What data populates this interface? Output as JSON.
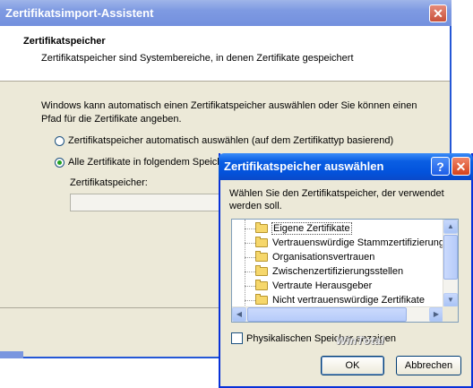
{
  "wizard": {
    "title": "Zertifikatsimport-Assistent",
    "close_symbol": "✕",
    "header_title": "Zertifikatspeicher",
    "header_subtitle": "Zertifikatspeicher sind Systembereiche, in denen Zertifikate gespeichert",
    "intro_text": "Windows kann automatisch einen Zertifikatspeicher auswählen oder Sie können einen Pfad für die Zertifikate angeben.",
    "radio_auto_label": "Zertifikatspeicher automatisch auswählen (auf dem Zertifikattyp basierend)",
    "radio_manual_label": "Alle Zertifikate in folgendem Speicher speichern",
    "store_label": "Zertifikatspeicher:",
    "store_value": ""
  },
  "dialog": {
    "title": "Zertifikatspeicher auswählen",
    "help_symbol": "?",
    "close_symbol": "✕",
    "instruction": "Wählen Sie den Zertifikatspeicher, der verwendet werden soll.",
    "stores": [
      "Eigene Zertifikate",
      "Vertrauenswürdige Stammzertifizierungss",
      "Organisationsvertrauen",
      "Zwischenzertifizierungsstellen",
      "Vertraute Herausgeber",
      "Nicht vertrauenswürdige Zertifikate"
    ],
    "selected_index": 0,
    "show_physical_label": "Physikalischen Speicher anzeigen",
    "show_physical_checked": false,
    "ok_label": "OK",
    "cancel_label": "Abbrechen"
  },
  "watermark": "WinTotal",
  "colors": {
    "dialog_title_blue": "#0353dc",
    "wizard_title_inactive": "#7e9ae2",
    "window_face": "#ece9d8",
    "close_red": "#d5421b"
  }
}
